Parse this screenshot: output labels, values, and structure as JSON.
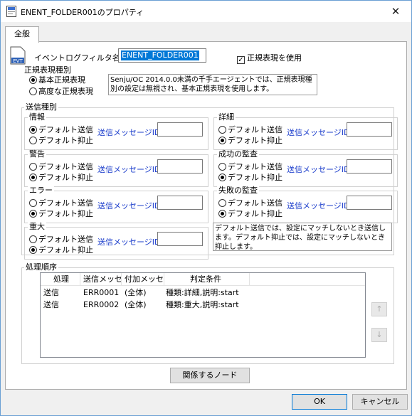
{
  "window": {
    "title": "ENENT_FOLDER001のプロパティ",
    "close_glyph": "✕",
    "icon_text": "EVT"
  },
  "tabs": [
    {
      "label": "全般"
    }
  ],
  "filter": {
    "name_label": "イベントログフィルタ名：",
    "name_value": "ENENT_FOLDER001",
    "regex_checkbox_label": "正規表現を使用",
    "regex_checked": true
  },
  "regex_type": {
    "group_label": "正規表現種別",
    "options": [
      "基本正規表現",
      "高度な正規表現"
    ],
    "selected": 0,
    "note": "Senju/OC 2014.0.0未満の千手エージェントでは、正規表現種別の設定は無視され、基本正規表現を使用します。"
  },
  "send_types": {
    "group_label": "送信種別",
    "msgid_label": "送信メッセージID：",
    "option_send": "デフォルト送信",
    "option_suppress": "デフォルト抑止",
    "groups": [
      {
        "label": "情報",
        "selected": 0,
        "msgid": ""
      },
      {
        "label": "詳細",
        "selected": 1,
        "msgid": ""
      },
      {
        "label": "警告",
        "selected": 1,
        "msgid": ""
      },
      {
        "label": "成功の監査",
        "selected": 1,
        "msgid": ""
      },
      {
        "label": "エラー",
        "selected": 1,
        "msgid": ""
      },
      {
        "label": "失敗の監査",
        "selected": 1,
        "msgid": ""
      },
      {
        "label": "重大",
        "selected": 1,
        "msgid": ""
      }
    ],
    "note": "デフォルト送信では、設定にマッチしないとき送信します。デフォルト抑止では、設定にマッチしないとき抑止します。"
  },
  "process_order": {
    "group_label": "処理順序",
    "columns": [
      "処理",
      "送信メッセ...",
      "付加メッセ...",
      "判定条件"
    ],
    "rows": [
      [
        "送信",
        "ERR0001",
        "(全体)",
        "種類:詳細,説明:start"
      ],
      [
        "送信",
        "ERR0002",
        "(全体)",
        "種類:重大,説明:start"
      ]
    ],
    "up_glyph": "↑",
    "down_glyph": "↓"
  },
  "buttons": {
    "related_nodes": "関係するノード",
    "ok": "OK",
    "cancel": "キャンセル"
  }
}
